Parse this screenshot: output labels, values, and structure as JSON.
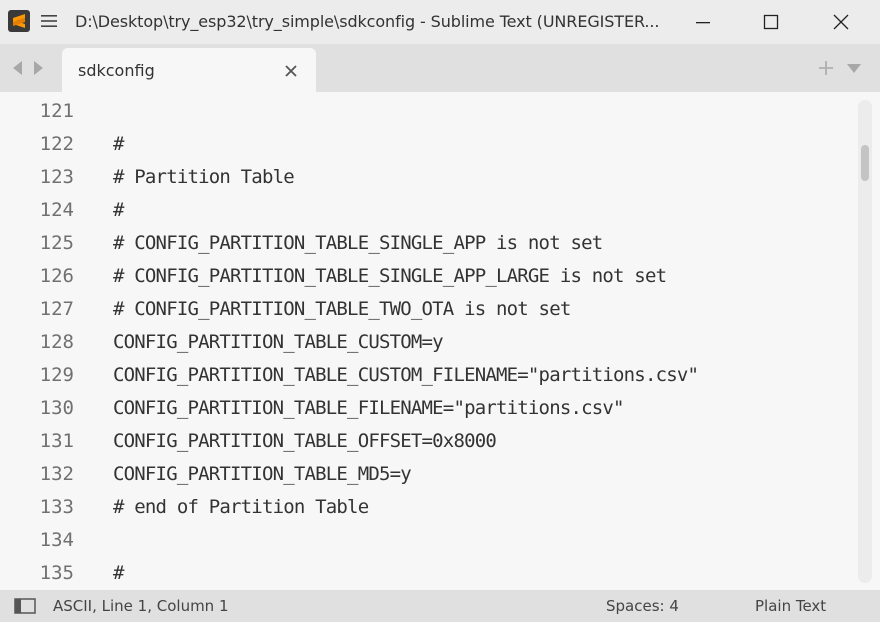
{
  "window": {
    "title": "D:\\Desktop\\try_esp32\\try_simple\\sdkconfig - Sublime Text (UNREGISTER..."
  },
  "icons": {
    "app": "sublime-logo-icon",
    "menu": "hamburger-menu-icon",
    "minimize": "minimize-icon",
    "maximize": "maximize-icon",
    "close": "close-icon"
  },
  "colors": {
    "accent_logo": "#ff9800",
    "background": "#f7f7f7",
    "chrome": "#e0e0e0"
  },
  "tabs": [
    {
      "label": "sdkconfig",
      "active": true
    }
  ],
  "editor": {
    "lines": [
      {
        "num": "121",
        "text": ""
      },
      {
        "num": "122",
        "text": "#"
      },
      {
        "num": "123",
        "text": "# Partition Table"
      },
      {
        "num": "124",
        "text": "#"
      },
      {
        "num": "125",
        "text": "# CONFIG_PARTITION_TABLE_SINGLE_APP is not set"
      },
      {
        "num": "126",
        "text": "# CONFIG_PARTITION_TABLE_SINGLE_APP_LARGE is not set"
      },
      {
        "num": "127",
        "text": "# CONFIG_PARTITION_TABLE_TWO_OTA is not set"
      },
      {
        "num": "128",
        "text": "CONFIG_PARTITION_TABLE_CUSTOM=y"
      },
      {
        "num": "129",
        "text": "CONFIG_PARTITION_TABLE_CUSTOM_FILENAME=\"partitions.csv\""
      },
      {
        "num": "130",
        "text": "CONFIG_PARTITION_TABLE_FILENAME=\"partitions.csv\""
      },
      {
        "num": "131",
        "text": "CONFIG_PARTITION_TABLE_OFFSET=0x8000"
      },
      {
        "num": "132",
        "text": "CONFIG_PARTITION_TABLE_MD5=y"
      },
      {
        "num": "133",
        "text": "# end of Partition Table"
      },
      {
        "num": "134",
        "text": ""
      },
      {
        "num": "135",
        "text": "#"
      }
    ]
  },
  "status": {
    "position": "ASCII, Line 1, Column 1",
    "spaces": "Spaces: 4",
    "syntax": "Plain Text"
  }
}
